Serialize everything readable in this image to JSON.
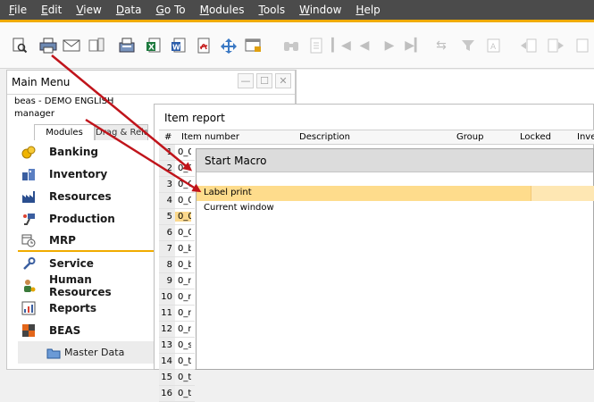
{
  "menubar": {
    "items": [
      {
        "label": "File",
        "mnemonic": "F",
        "rest": "ile"
      },
      {
        "label": "Edit",
        "mnemonic": "E",
        "rest": "dit"
      },
      {
        "label": "View",
        "mnemonic": "V",
        "rest": "iew"
      },
      {
        "label": "Data",
        "mnemonic": "D",
        "rest": "ata"
      },
      {
        "label": "Go To",
        "mnemonic": "G",
        "rest": "o To"
      },
      {
        "label": "Modules",
        "mnemonic": "M",
        "rest": "odules"
      },
      {
        "label": "Tools",
        "mnemonic": "T",
        "rest": "ools"
      },
      {
        "label": "Window",
        "mnemonic": "W",
        "rest": "indow"
      },
      {
        "label": "Help",
        "mnemonic": "H",
        "rest": "elp"
      }
    ]
  },
  "toolbar": {
    "icons": [
      "preview-icon",
      "print-icon",
      "email-icon",
      "sms-icon",
      "fax-icon",
      "excel-icon",
      "word-icon",
      "pdf-icon",
      "launch-app-icon",
      "lock-screen-icon",
      "find-icon",
      "add-icon",
      "first-record-icon",
      "previous-record-icon",
      "next-record-icon",
      "last-record-icon",
      "refresh-icon",
      "filter-icon",
      "sort-icon",
      "base-document-icon",
      "target-document-icon"
    ]
  },
  "main_menu": {
    "title": "Main Menu",
    "company": "beas - DEMO ENGLISH",
    "user": "manager",
    "tabs": [
      "Modules",
      "Drag & Relate"
    ],
    "modules": [
      {
        "label": "Banking",
        "icon": "banking-icon"
      },
      {
        "label": "Inventory",
        "icon": "inventory-icon"
      },
      {
        "label": "Resources",
        "icon": "resources-icon"
      },
      {
        "label": "Production",
        "icon": "production-icon"
      },
      {
        "label": "MRP",
        "icon": "mrp-icon"
      },
      {
        "label": "Service",
        "icon": "service-icon"
      },
      {
        "label": "Human Resources",
        "icon": "human-resources-icon"
      },
      {
        "label": "Reports",
        "icon": "reports-icon"
      },
      {
        "label": "BEAS",
        "icon": "beas-icon"
      },
      {
        "label": "Master Data",
        "icon": "folder-icon"
      }
    ]
  },
  "item_report": {
    "title": "Item report",
    "columns": [
      "#",
      "Item number",
      "Description",
      "Group",
      "Locked",
      "Inve"
    ],
    "rows": [
      {
        "n": "1",
        "v": "0_0"
      },
      {
        "n": "2",
        "v": "0_0"
      },
      {
        "n": "3",
        "v": "0_0"
      },
      {
        "n": "4",
        "v": "0_0"
      },
      {
        "n": "5",
        "v": "0_0"
      },
      {
        "n": "6",
        "v": "0_0"
      },
      {
        "n": "7",
        "v": "0_b"
      },
      {
        "n": "8",
        "v": "0_b"
      },
      {
        "n": "9",
        "v": "0_m"
      },
      {
        "n": "10",
        "v": "0_m"
      },
      {
        "n": "11",
        "v": "0_m"
      },
      {
        "n": "12",
        "v": "0_n"
      },
      {
        "n": "13",
        "v": "0_s"
      },
      {
        "n": "14",
        "v": "0_t"
      },
      {
        "n": "15",
        "v": "0_t"
      },
      {
        "n": "16",
        "v": "0_t"
      }
    ]
  },
  "start_macro": {
    "title": "Start Macro",
    "options": [
      "Label print",
      "Current window"
    ]
  },
  "colors": {
    "menubar_bg": "#4b4b4b",
    "accent": "#f0ab00",
    "selection": "#fedc8c",
    "arrow": "#c0141b"
  }
}
